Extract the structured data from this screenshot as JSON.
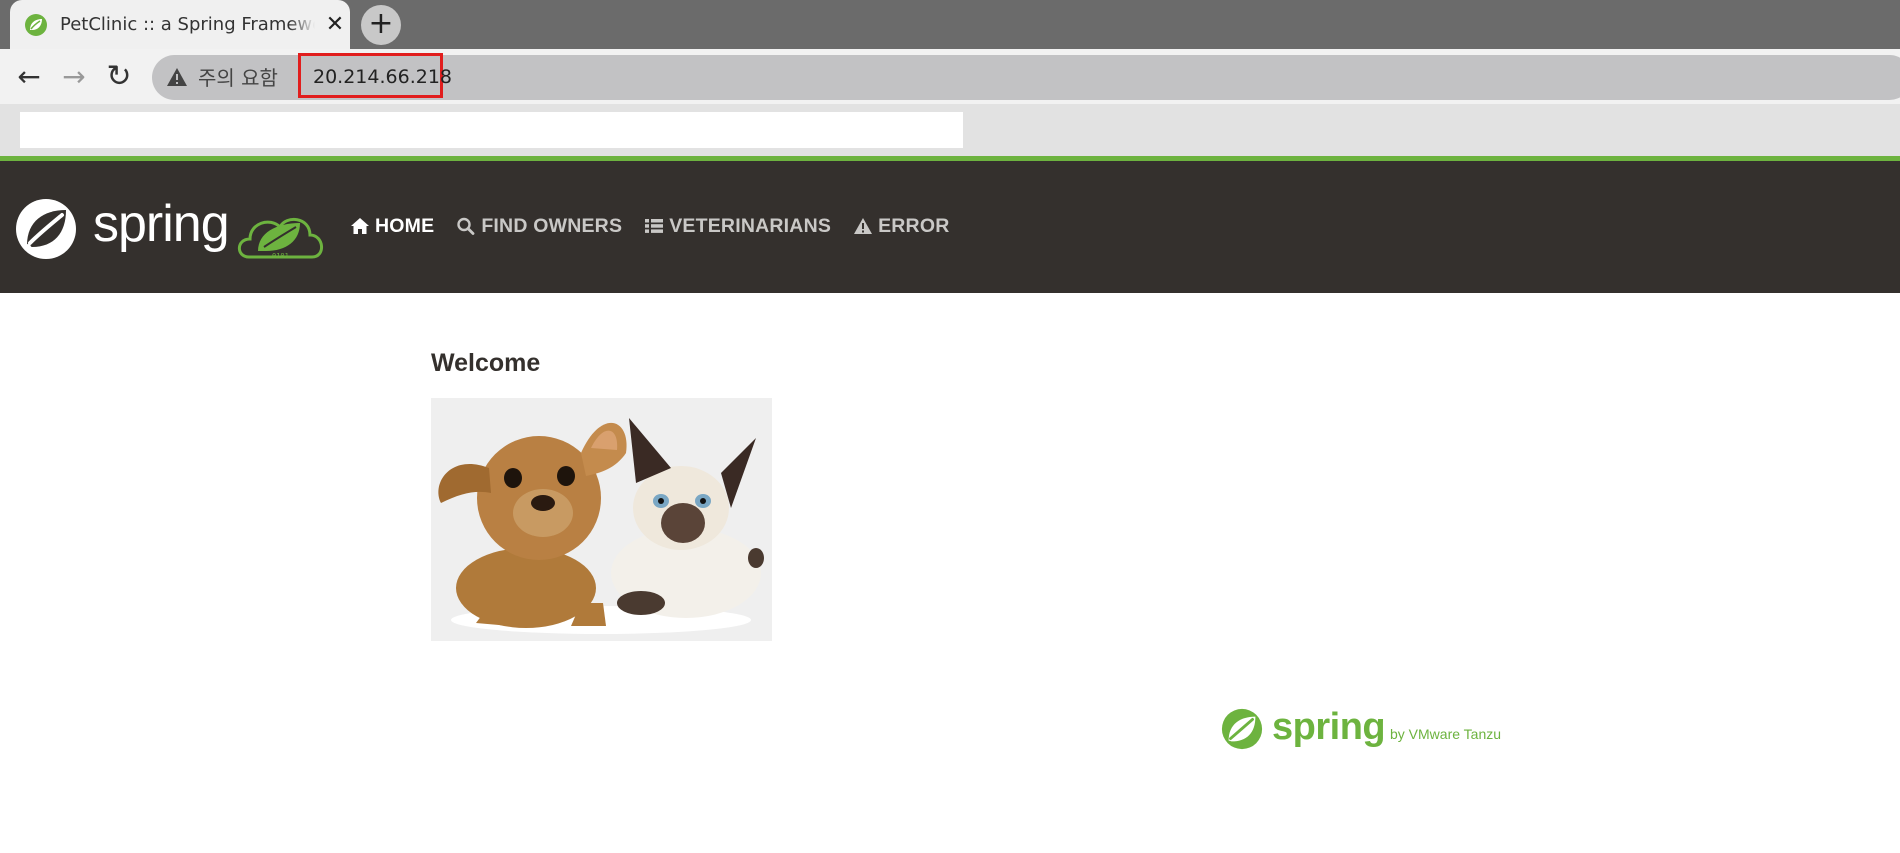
{
  "browser": {
    "tab_title": "PetClinic :: a Spring Framework demonstration",
    "tab_close": "✕",
    "new_tab": "+",
    "back": "←",
    "forward": "→",
    "reload": "↻",
    "security_label": "주의 요함",
    "url": "20.214.66.218"
  },
  "navbar": {
    "brand": "spring",
    "items": [
      {
        "label": "HOME",
        "icon": "home-icon",
        "active": true
      },
      {
        "label": "FIND OWNERS",
        "icon": "search-icon",
        "active": false
      },
      {
        "label": "VETERINARIANS",
        "icon": "list-icon",
        "active": false
      },
      {
        "label": "ERROR",
        "icon": "warning-icon",
        "active": false
      }
    ]
  },
  "main": {
    "heading": "Welcome",
    "image": "pets-image"
  },
  "footer": {
    "logo_word": "spring",
    "byline": "by VMware Tanzu"
  },
  "colors": {
    "spring_green": "#6db33f",
    "navbar_bg": "#34302d",
    "url_highlight": "#e11d1d"
  }
}
